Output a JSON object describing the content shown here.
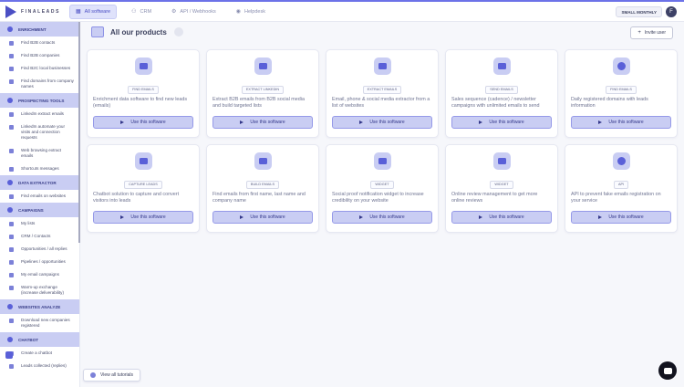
{
  "brand": {
    "name": "FINALEADS"
  },
  "topnav": [
    {
      "label": "All software",
      "icon": "grid-icon",
      "active": true
    },
    {
      "label": "CRM",
      "icon": "crm-icon",
      "active": false
    },
    {
      "label": "API / Webhooks",
      "icon": "api-icon",
      "active": false
    },
    {
      "label": "Helpdesk",
      "icon": "helpdesk-icon",
      "active": false
    }
  ],
  "account": {
    "plan": "SMALL MONTHLY",
    "avatar_letter": "F"
  },
  "sidebar": {
    "sections": [
      {
        "title": "ENRICHMENT",
        "items": [
          "Find B2B contacts",
          "Find B2B companies",
          "Find B2C local businesses",
          "Find domains from company names"
        ]
      },
      {
        "title": "PROSPECTING TOOLS",
        "items": [
          "LinkedIn extract emails",
          "LinkedIn automate your visits and connection requests",
          "Web browsing extract emails",
          "Shortcuts messages"
        ]
      },
      {
        "title": "DATA EXTRACTOR",
        "items": [
          "Find emails on websites"
        ]
      },
      {
        "title": "CAMPAIGNS",
        "items": [
          "My lists",
          "CRM / Contacts",
          "Opportunities / all replies",
          "Pipelines / opportunities",
          "My email campaigns",
          "Warm-up exchange (increase deliverability)"
        ]
      },
      {
        "title": "WEBSITES ANALYZE",
        "items": [
          "Download new companies registered"
        ]
      },
      {
        "title": "CHATBOT",
        "items": [
          "Create a chatbot",
          "Leads collected (replies)"
        ]
      }
    ]
  },
  "main": {
    "title": "All our products",
    "invite_label": "Invite user",
    "tutorials_label": "View all tutorials",
    "use_label": "Use this software"
  },
  "products": [
    {
      "tag": "FIND EMAILS",
      "desc": "Enrichment data software to find new leads (emails)",
      "icon": "find-emails-icon"
    },
    {
      "tag": "EXTRACT LINKEDIN",
      "desc": "Extract B2B emails from B2B social media and build targeted lists",
      "icon": "linkedin-extract-icon"
    },
    {
      "tag": "EXTRACT EMAILS",
      "desc": "Email, phone & social media extractor from a list of websites",
      "icon": "extract-emails-icon"
    },
    {
      "tag": "SEND EMAILS",
      "desc": "Sales sequence (cadence) / newsletter campaigns with unlimited emails to send",
      "icon": "send-emails-icon"
    },
    {
      "tag": "FIND EMAILS",
      "desc": "Daily registered domains with leads information",
      "icon": "domains-icon"
    },
    {
      "tag": "CAPTURE LEADS",
      "desc": "Chatbot solution to capture and convert visitors into leads",
      "icon": "chatbot-icon"
    },
    {
      "tag": "BUILD EMAILS",
      "desc": "Find emails from first name, last name and company name",
      "icon": "build-emails-icon"
    },
    {
      "tag": "WIDGET",
      "desc": "Social proof notification widget to increase credibility on your website",
      "icon": "widget-icon"
    },
    {
      "tag": "WIDGET",
      "desc": "Online review management to get more online reviews",
      "icon": "reviews-icon"
    },
    {
      "tag": "API",
      "desc": "API to prevent fake emails registration on your service",
      "icon": "api-protect-icon"
    }
  ]
}
